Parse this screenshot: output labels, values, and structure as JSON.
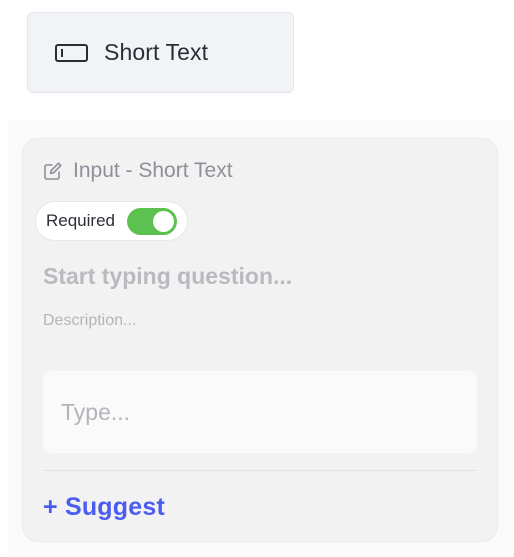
{
  "palette": {
    "item_label": "Short Text",
    "item_icon": "text-field-icon"
  },
  "card": {
    "header_icon": "edit-icon",
    "header_title": "Input - Short Text",
    "required_label": "Required",
    "required_enabled": true,
    "question_placeholder": "Start typing question...",
    "description_placeholder": "Description...",
    "answer_placeholder": "Type...",
    "suggest_label": "+ Suggest"
  },
  "colors": {
    "accent": "#4a5df0",
    "toggle_on": "#5cc14f",
    "tile_bg": "#f2f3f6",
    "card_bg": "#f2f2f3"
  }
}
